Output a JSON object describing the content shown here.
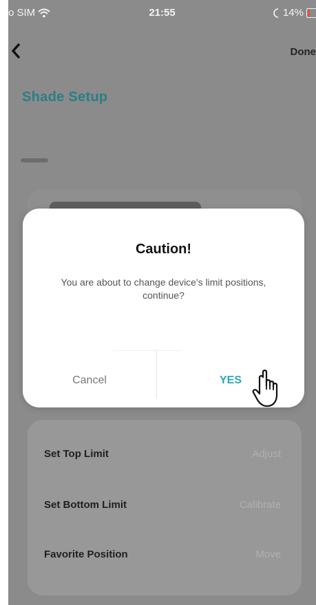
{
  "status_bar": {
    "carrier": "o SIM",
    "time": "21:55",
    "battery": "14%"
  },
  "nav": {
    "done_label": "Done"
  },
  "page": {
    "title": "Shade Setup"
  },
  "settings": [
    {
      "label": "Set Top Limit",
      "value": "Adjust"
    },
    {
      "label": "Set Bottom Limit",
      "value": "Calibrate"
    },
    {
      "label": "Favorite Position",
      "value": "Move"
    }
  ],
  "dialog": {
    "title": "Caution!",
    "message": "You are about to change device's limit positions, continue?",
    "cancel_label": "Cancel",
    "confirm_label": "YES"
  },
  "colors": {
    "accent": "#2aa8b6",
    "title_teal": "#2a7f86",
    "overlay_gray": "#8b8b8b"
  },
  "icons": {
    "back": "chevron-left-icon",
    "wifi": "wifi-icon",
    "battery": "battery-icon",
    "cursor": "hand-pointer-icon"
  }
}
